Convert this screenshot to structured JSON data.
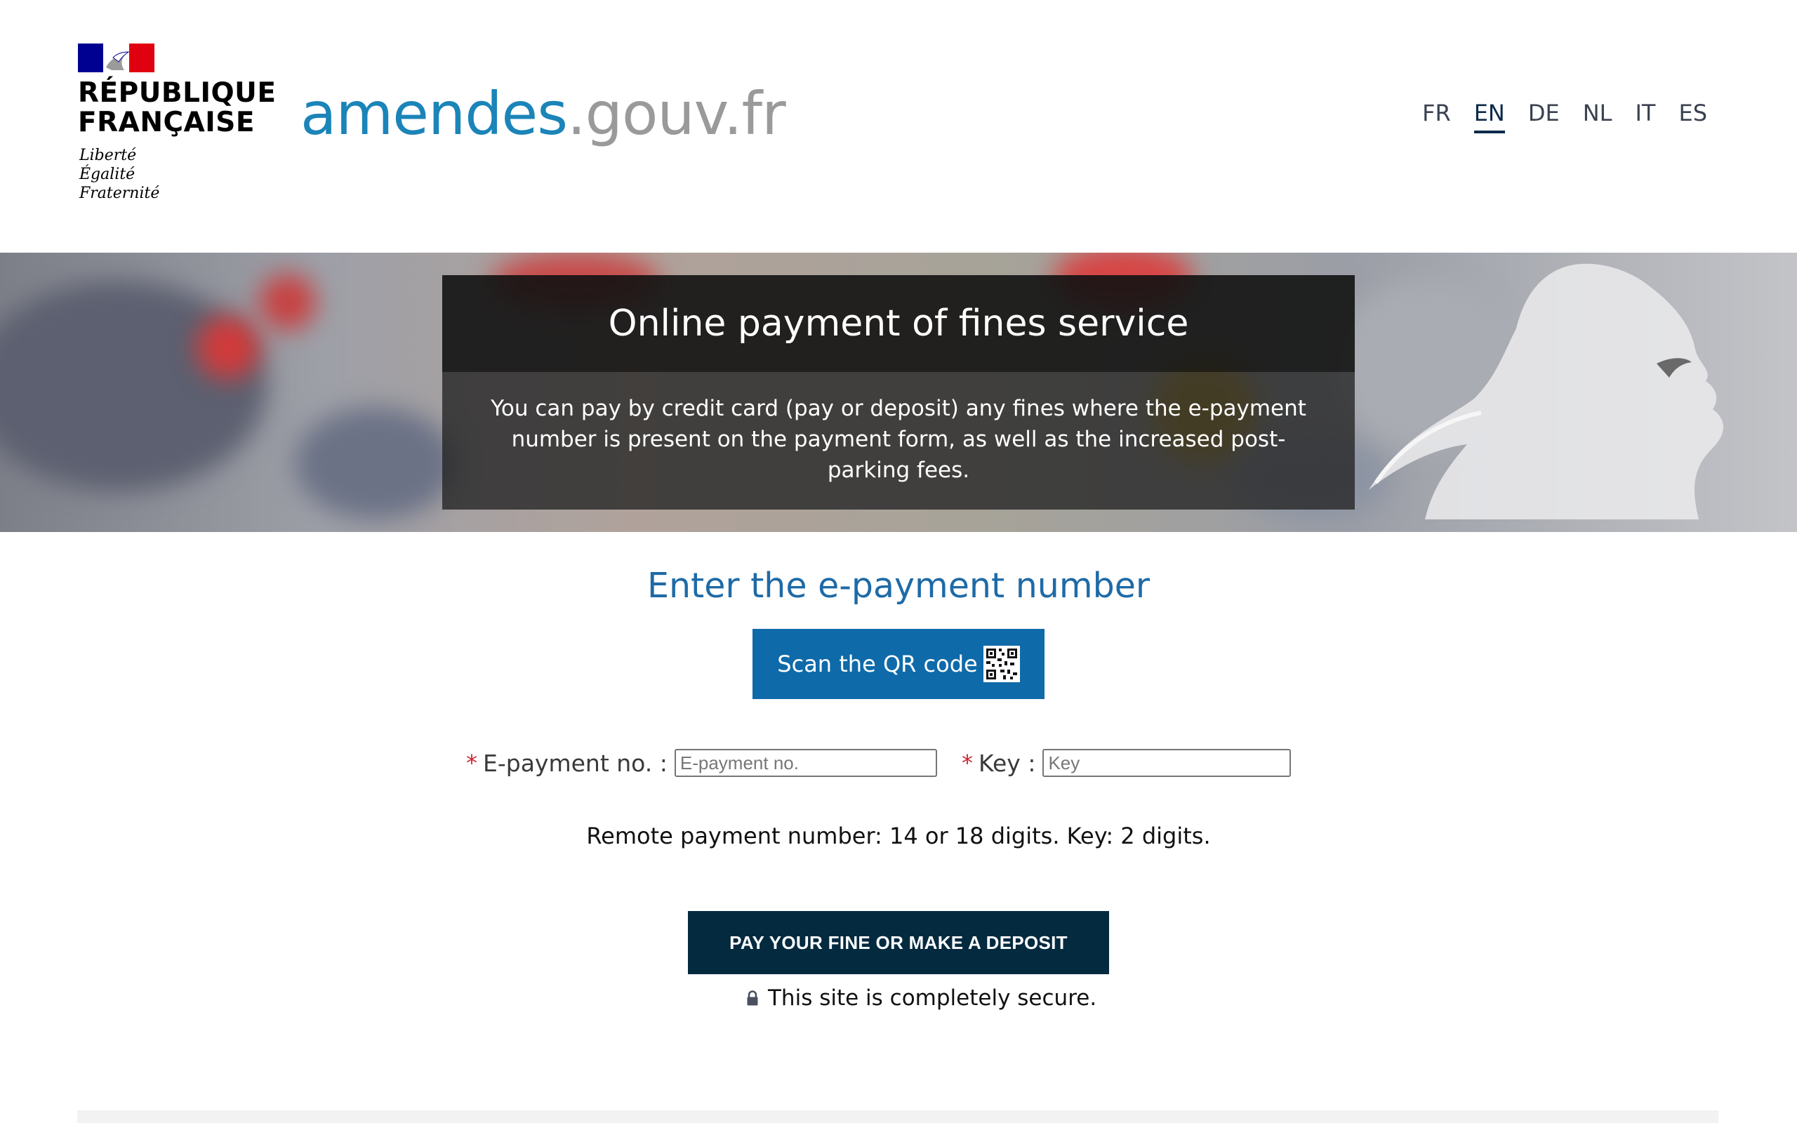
{
  "header": {
    "logo": {
      "title": "RÉPUBLIQUE\nFRANÇAISE",
      "motto": "Liberté\nÉgalité\nFraternité"
    },
    "site_name_part1": "amendes",
    "site_name_part2": ".gouv.fr",
    "languages": [
      {
        "code": "FR",
        "active": false
      },
      {
        "code": "EN",
        "active": true
      },
      {
        "code": "DE",
        "active": false
      },
      {
        "code": "NL",
        "active": false
      },
      {
        "code": "IT",
        "active": false
      },
      {
        "code": "ES",
        "active": false
      }
    ]
  },
  "hero": {
    "title": "Online payment of fines service",
    "description": "You can pay by credit card (pay or deposit) any fines where the e-payment number is present on the payment form, as well as the increased post-parking fees."
  },
  "form": {
    "section_title": "Enter the e-payment number",
    "qr_button_label": "Scan the QR code",
    "qr_icon": "qr-code-icon",
    "required_marker": "*",
    "epayment_label": "E-payment no. :",
    "epayment_placeholder": "E-payment no.",
    "epayment_value": "",
    "key_label": "Key :",
    "key_placeholder": "Key",
    "key_value": "",
    "hint": "Remote payment number: 14 or 18 digits. Key: 2 digits.",
    "submit_label": "PAY YOUR FINE OR MAKE A DEPOSIT",
    "secure_icon": "lock-icon",
    "secure_text": "This site is completely secure."
  },
  "colors": {
    "brand_blue": "#1b84b8",
    "title_blue": "#1e6aa6",
    "qr_button": "#0f6aa9",
    "submit_button": "#042a40",
    "required": "#d0262e",
    "flag_blue": "#000091",
    "flag_red": "#e1000f"
  }
}
